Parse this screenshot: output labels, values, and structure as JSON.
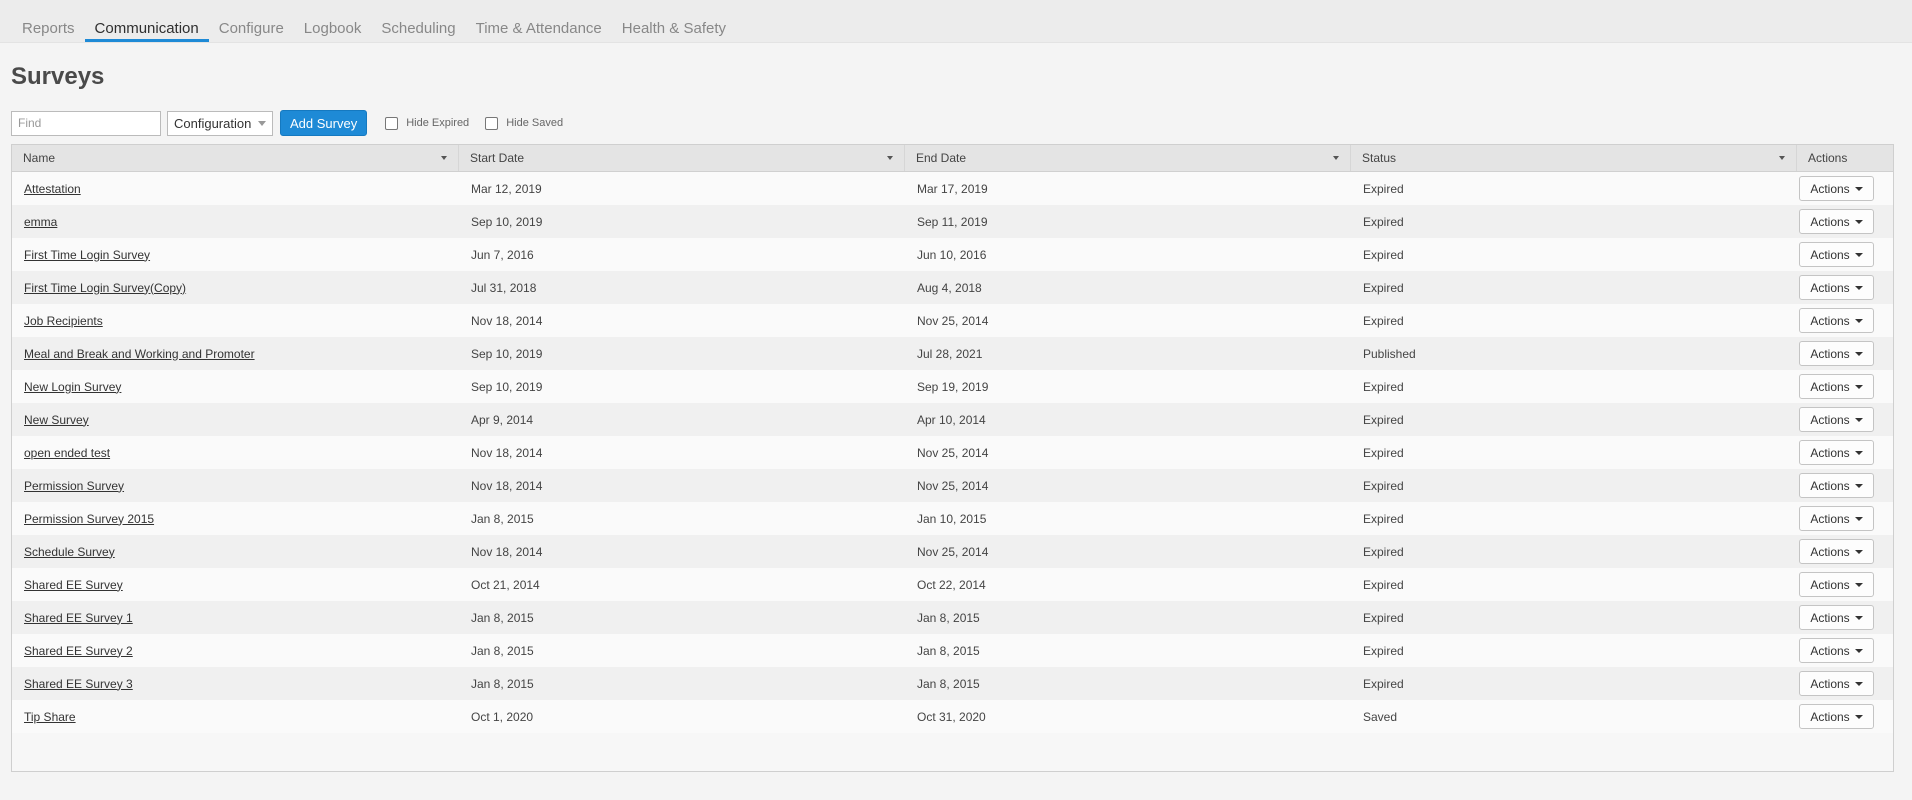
{
  "nav": {
    "tabs": [
      {
        "label": "Reports",
        "active": false
      },
      {
        "label": "Communication",
        "active": true
      },
      {
        "label": "Configure",
        "active": false
      },
      {
        "label": "Logbook",
        "active": false
      },
      {
        "label": "Scheduling",
        "active": false
      },
      {
        "label": "Time & Attendance",
        "active": false
      },
      {
        "label": "Health & Safety",
        "active": false
      }
    ]
  },
  "page": {
    "title": "Surveys"
  },
  "toolbar": {
    "find_placeholder": "Find",
    "find_value": "",
    "filter_selected": "Configuration",
    "add_label": "Add Survey",
    "hide_expired_label": "Hide Expired",
    "hide_saved_label": "Hide Saved"
  },
  "table": {
    "columns": [
      "Name",
      "Start Date",
      "End Date",
      "Status",
      "Actions"
    ],
    "action_label": "Actions",
    "rows": [
      {
        "name": "Attestation",
        "start": "Mar 12, 2019",
        "end": "Mar 17, 2019",
        "status": "Expired"
      },
      {
        "name": "emma",
        "start": "Sep 10, 2019",
        "end": "Sep 11, 2019",
        "status": "Expired"
      },
      {
        "name": "First Time Login Survey",
        "start": "Jun 7, 2016",
        "end": "Jun 10, 2016",
        "status": "Expired"
      },
      {
        "name": "First Time Login Survey(Copy)",
        "start": "Jul 31, 2018",
        "end": "Aug 4, 2018",
        "status": "Expired"
      },
      {
        "name": "Job Recipients",
        "start": "Nov 18, 2014",
        "end": "Nov 25, 2014",
        "status": "Expired"
      },
      {
        "name": "Meal and Break and Working and Promoter",
        "start": "Sep 10, 2019",
        "end": "Jul 28, 2021",
        "status": "Published"
      },
      {
        "name": "New Login Survey",
        "start": "Sep 10, 2019",
        "end": "Sep 19, 2019",
        "status": "Expired"
      },
      {
        "name": "New Survey",
        "start": "Apr 9, 2014",
        "end": "Apr 10, 2014",
        "status": "Expired"
      },
      {
        "name": "open ended test",
        "start": "Nov 18, 2014",
        "end": "Nov 25, 2014",
        "status": "Expired"
      },
      {
        "name": "Permission Survey",
        "start": "Nov 18, 2014",
        "end": "Nov 25, 2014",
        "status": "Expired"
      },
      {
        "name": "Permission Survey 2015",
        "start": "Jan 8, 2015",
        "end": "Jan 10, 2015",
        "status": "Expired"
      },
      {
        "name": "Schedule Survey",
        "start": "Nov 18, 2014",
        "end": "Nov 25, 2014",
        "status": "Expired"
      },
      {
        "name": "Shared EE Survey",
        "start": "Oct 21, 2014",
        "end": "Oct 22, 2014",
        "status": "Expired"
      },
      {
        "name": "Shared EE Survey 1",
        "start": "Jan 8, 2015",
        "end": "Jan 8, 2015",
        "status": "Expired"
      },
      {
        "name": "Shared EE Survey 2",
        "start": "Jan 8, 2015",
        "end": "Jan 8, 2015",
        "status": "Expired"
      },
      {
        "name": "Shared EE Survey 3",
        "start": "Jan 8, 2015",
        "end": "Jan 8, 2015",
        "status": "Expired"
      },
      {
        "name": "Tip Share",
        "start": "Oct 1, 2020",
        "end": "Oct 31, 2020",
        "status": "Saved"
      }
    ]
  },
  "colors": {
    "accent": "#1e8ad6",
    "background": "#f4f4f4"
  }
}
